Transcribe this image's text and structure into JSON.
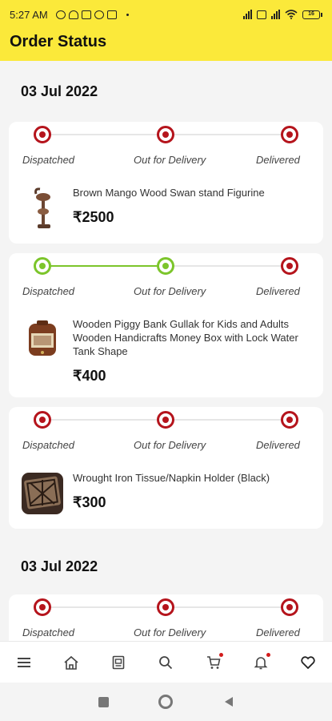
{
  "status_bar": {
    "time": "5:27 AM",
    "battery": "16"
  },
  "app_bar": {
    "title": "Order Status"
  },
  "steps": [
    "Dispatched",
    "Out for Delivery",
    "Delivered"
  ],
  "orders": [
    {
      "date": "03 Jul 2022",
      "items": [
        {
          "name": "Brown Mango Wood Swan stand Figurine",
          "price": "₹2500",
          "progress": 0,
          "thumb": "figurine-image"
        },
        {
          "name": "Wooden Piggy Bank Gullak for Kids and Adults Wooden Handicrafts Money Box with Lock Water Tank Shape",
          "price": "₹400",
          "progress": 2,
          "thumb": "piggy-bank-image"
        },
        {
          "name": "Wrought Iron Tissue/Napkin Holder (Black)",
          "price": "₹300",
          "progress": 0,
          "thumb": "napkin-holder-image"
        }
      ]
    },
    {
      "date": "03 Jul 2022",
      "items": [
        {
          "name": "",
          "price": "",
          "progress": 0,
          "thumb": ""
        }
      ]
    }
  ],
  "bottom_nav": [
    "menu-icon",
    "home-icon",
    "orders-icon",
    "search-icon",
    "cart-icon",
    "notifications-icon",
    "wishlist-icon"
  ],
  "colors": {
    "accent": "#fbe93a",
    "pending": "#b5141c",
    "done": "#7cc52b"
  }
}
